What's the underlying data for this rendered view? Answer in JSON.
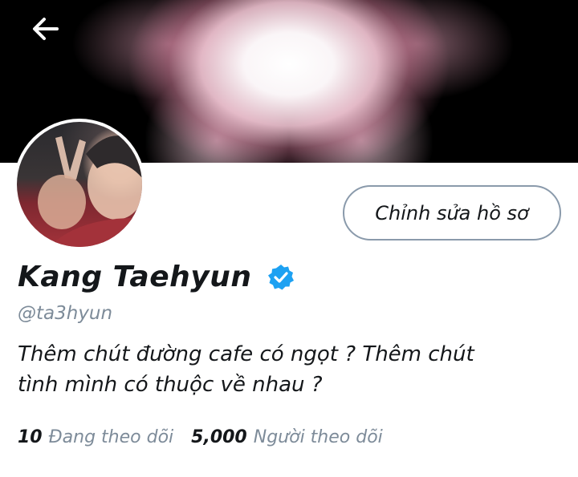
{
  "header": {
    "back_icon": "arrow-left-icon"
  },
  "profile": {
    "edit_button_label": "Chỉnh sửa hồ sơ",
    "display_name": "Kang Taehyun",
    "verified_icon": "verified-badge-icon",
    "handle": "@ta3hyun",
    "bio_line1": "Thêm chút đường cafe có ngọt ? Thêm chút",
    "bio_line2": "tình mình có thuộc về nhau ?",
    "following_count": "10",
    "following_label": "Đang theo dõi",
    "followers_count": "5,000",
    "followers_label": "Người theo dõi"
  },
  "colors": {
    "accent_blue": "#1da1f2",
    "secondary_text": "#7d8b99",
    "primary_text": "#14171a",
    "button_border": "#8a9aab"
  }
}
